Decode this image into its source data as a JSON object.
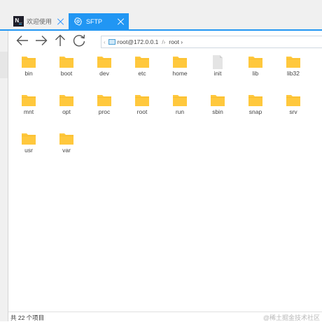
{
  "tabs": [
    {
      "label": "欢迎使用",
      "logo": "N_",
      "active": false
    },
    {
      "label": "SFTP",
      "active": true
    }
  ],
  "toolbar": {
    "back": "arrow-left-icon",
    "forward": "arrow-right-icon",
    "up": "arrow-up-icon",
    "refresh": "refresh-icon"
  },
  "path": {
    "lead": "‹",
    "host": "root@172.0.0.1",
    "separator": "/›",
    "current": "root ›"
  },
  "files": [
    {
      "name": "bin",
      "type": "folder"
    },
    {
      "name": "boot",
      "type": "folder"
    },
    {
      "name": "dev",
      "type": "folder"
    },
    {
      "name": "etc",
      "type": "folder"
    },
    {
      "name": "home",
      "type": "folder"
    },
    {
      "name": "init",
      "type": "file"
    },
    {
      "name": "lib",
      "type": "folder"
    },
    {
      "name": "lib32",
      "type": "folder"
    },
    {
      "name": "mnt",
      "type": "folder"
    },
    {
      "name": "opt",
      "type": "folder"
    },
    {
      "name": "proc",
      "type": "folder"
    },
    {
      "name": "root",
      "type": "folder"
    },
    {
      "name": "run",
      "type": "folder"
    },
    {
      "name": "sbin",
      "type": "folder"
    },
    {
      "name": "snap",
      "type": "folder"
    },
    {
      "name": "srv",
      "type": "folder"
    },
    {
      "name": "usr",
      "type": "folder"
    },
    {
      "name": "var",
      "type": "folder"
    }
  ],
  "status": {
    "count_text": "共 22 个项目",
    "watermark": "@稀土掘金技术社区"
  },
  "colors": {
    "accent": "#2196f3",
    "folder": "#ffc83d",
    "file": "#e4e4e4"
  }
}
